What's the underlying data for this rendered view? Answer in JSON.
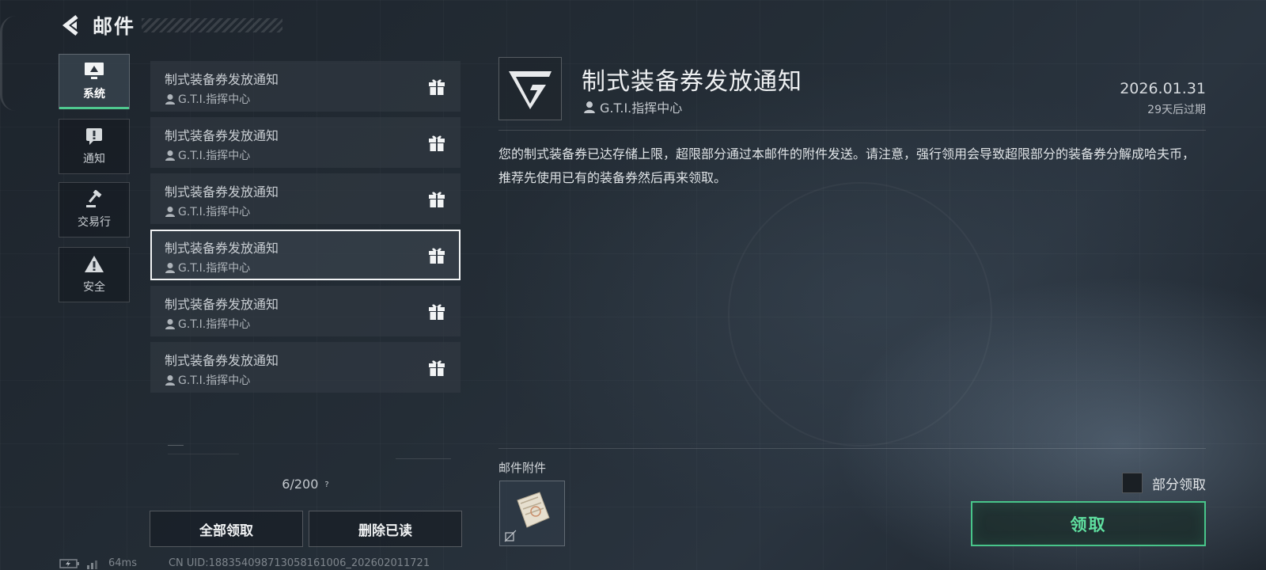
{
  "header": {
    "title": "邮件",
    "back_icon": "back-arrow-icon"
  },
  "categories": [
    {
      "label": "系统",
      "icon": "monitor-icon",
      "active": true
    },
    {
      "label": "通知",
      "icon": "exclamation-icon",
      "active": false
    },
    {
      "label": "交易行",
      "icon": "gavel-icon",
      "active": false
    },
    {
      "label": "安全",
      "icon": "warning-icon",
      "active": false
    }
  ],
  "mail_list": {
    "items": [
      {
        "title": "制式装备券发放通知",
        "sender": "G.T.I.指挥中心",
        "icon": "gift-icon"
      },
      {
        "title": "制式装备券发放通知",
        "sender": "G.T.I.指挥中心",
        "icon": "gift-icon"
      },
      {
        "title": "制式装备券发放通知",
        "sender": "G.T.I.指挥中心",
        "icon": "gift-icon"
      },
      {
        "title": "制式装备券发放通知",
        "sender": "G.T.I.指挥中心",
        "icon": "gift-icon",
        "selected": true
      },
      {
        "title": "制式装备券发放通知",
        "sender": "G.T.I.指挥中心",
        "icon": "gift-icon"
      },
      {
        "title": "制式装备券发放通知",
        "sender": "G.T.I.指挥中心",
        "icon": "gift-icon"
      }
    ],
    "count": "6/200",
    "help": "?",
    "claim_all_label": "全部领取",
    "delete_read_label": "删除已读"
  },
  "footer": {
    "ping": "64ms",
    "uid": "CN UID:188354098713058161006_202602011721"
  },
  "detail": {
    "title": "制式装备券发放通知",
    "sender": "G.T.I.指挥中心",
    "date": "2026.01.31",
    "expire": "29天后过期",
    "body": "您的制式装备券已达存储上限，超限部分通过本邮件的附件发送。请注意，强行领用会导致超限部分的装备券分解成哈夫币，推荐先使用已有的装备券然后再来领取。",
    "attachments_label": "邮件附件",
    "partial_claim_label": "部分领取",
    "claim_label": "领取"
  },
  "colors": {
    "accent_green": "#48c58a",
    "claim_text": "#5fe0a0",
    "background": "#242d36"
  }
}
